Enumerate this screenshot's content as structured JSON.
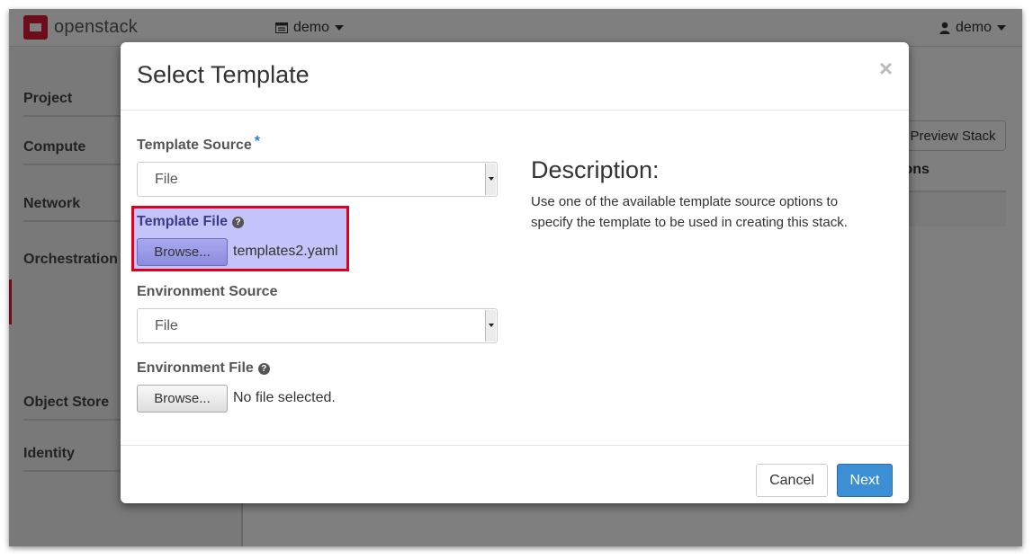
{
  "topnav": {
    "logo_text": "openstack",
    "project": "demo",
    "user": "demo"
  },
  "sidebar": {
    "items": [
      {
        "label": "Project"
      },
      {
        "label": "Compute"
      },
      {
        "label": "Network"
      },
      {
        "label": "Orchestration"
      },
      {
        "label": "Object Store"
      },
      {
        "label": "Identity"
      }
    ]
  },
  "background": {
    "preview_button": "Preview Stack",
    "table_header": "ions"
  },
  "modal": {
    "title": "Select Template",
    "close": "×",
    "template_source": {
      "label": "Template Source",
      "required_mark": "*",
      "value": "File"
    },
    "template_file": {
      "label": "Template File",
      "browse": "Browse...",
      "filename": "templates2.yaml"
    },
    "environment_source": {
      "label": "Environment Source",
      "value": "File"
    },
    "environment_file": {
      "label": "Environment File",
      "browse": "Browse...",
      "filename": "No file selected."
    },
    "description": {
      "title": "Description:",
      "text": "Use one of the available template source options to specify the template to be used in creating this stack."
    },
    "footer": {
      "cancel": "Cancel",
      "next": "Next"
    }
  },
  "colors": {
    "accent": "#da1a32",
    "primary": "#3c8fd4",
    "highlight": "#c4c4fb",
    "highlight_border": "#e0001b"
  }
}
